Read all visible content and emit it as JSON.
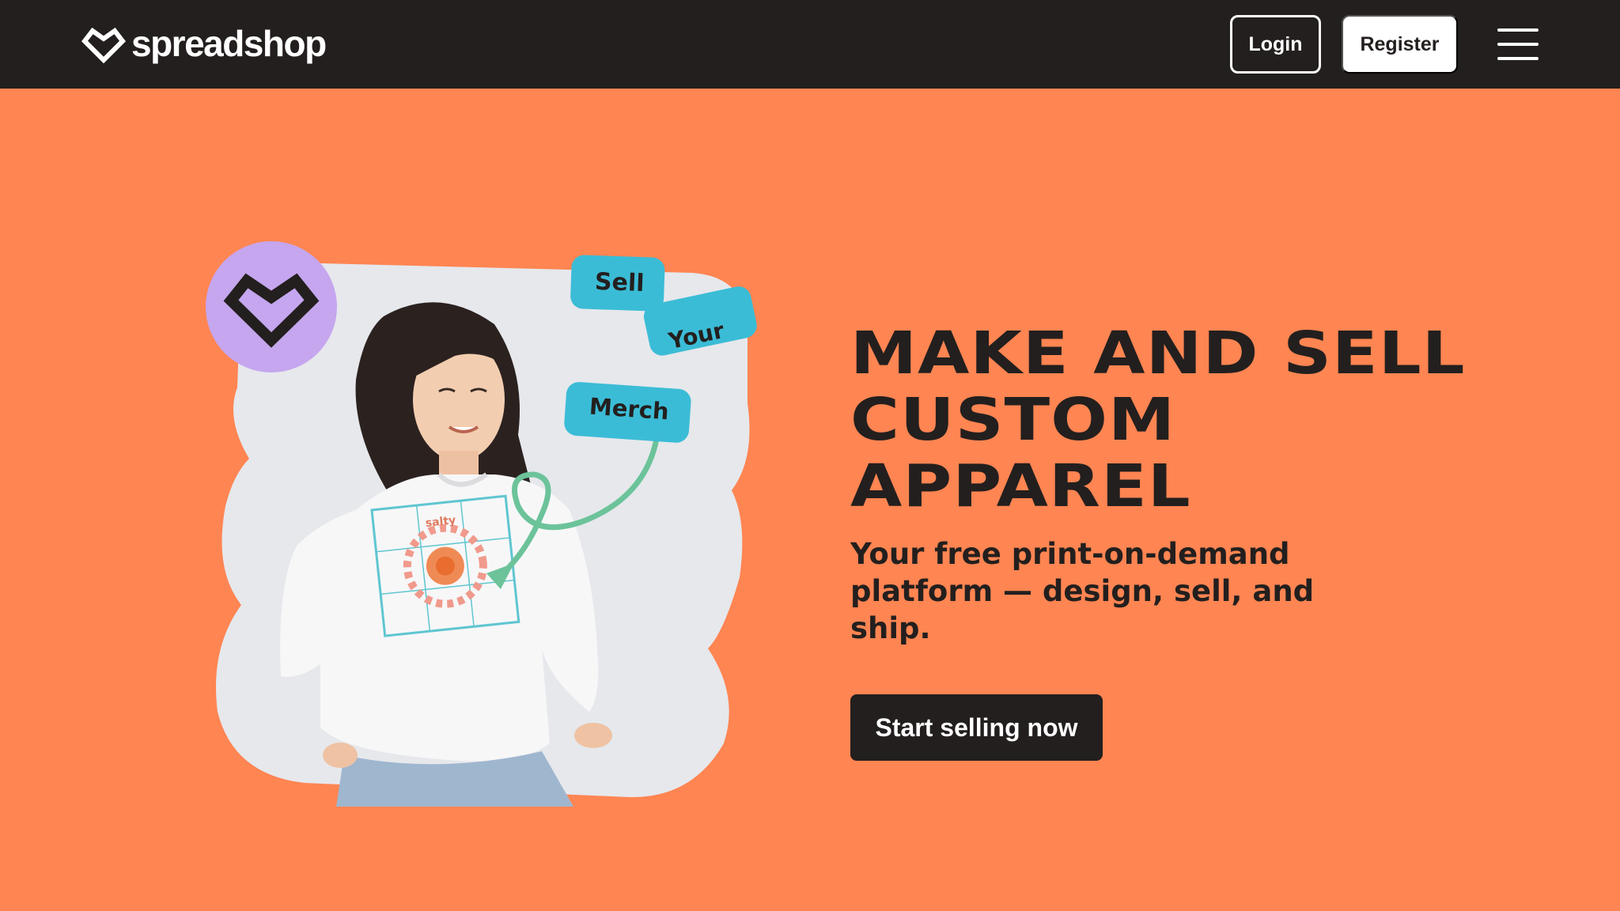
{
  "header": {
    "brand": "spreadshop",
    "login_label": "Login",
    "register_label": "Register",
    "menu_icon": "hamburger-icon"
  },
  "hero": {
    "title": "MAKE AND SELL CUSTOM APPAREL",
    "subtitle": "Your free print-on-demand platform — design, sell, and ship.",
    "cta_label": "Start selling now",
    "image": {
      "tags": [
        "Sell",
        "Your",
        "Merch"
      ],
      "shirt_print_text": "salty",
      "badge_icon": "spreadshop-heart-icon"
    }
  },
  "colors": {
    "nav_bg": "#231f1e",
    "page_bg": "#ff8552",
    "tag_bg": "#3bbcd6",
    "badge_bg": "#c5a6ef",
    "arrow": "#6cc39a"
  }
}
